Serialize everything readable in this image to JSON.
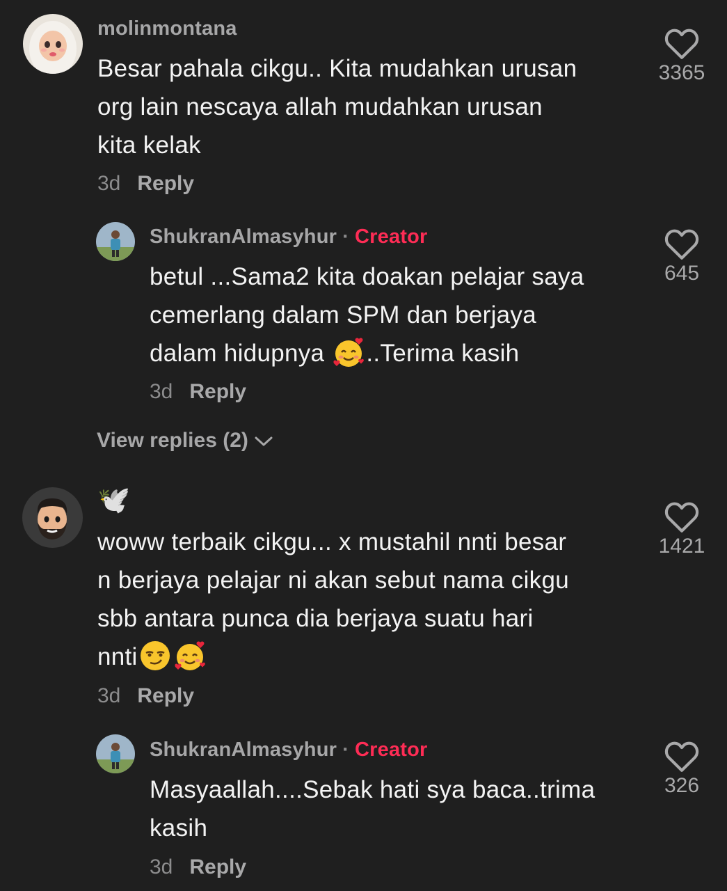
{
  "comments": [
    {
      "username": "molinmontana",
      "text": "Besar pahala cikgu.. Kita mudahkan urusan\norg lain nescaya allah mudahkan urusan\nkita kelak",
      "time": "3d",
      "reply_label": "Reply",
      "likes": "3365",
      "avatar_icon": "hijab-woman-avatar",
      "replies": [
        {
          "username": "ShukranAlmasyhur",
          "badge": "Creator",
          "separator": "·",
          "text_before_emoji": "betul ...Sama2 kita doakan pelajar saya\ncemerlang dalam SPM dan berjaya\ndalam hidupnya ",
          "emoji": "smiling-face-with-hearts",
          "text_after_emoji": "..Terima kasih",
          "time": "3d",
          "reply_label": "Reply",
          "likes": "645"
        }
      ],
      "view_replies": "View replies (2)"
    },
    {
      "username": "🕊️",
      "text_before_emoji": "woww terbaik cikgu... x mustahil nnti besar\nn berjaya pelajar ni akan sebut nama cikgu\nsbb antara punca dia berjaya suatu hari\nnnti",
      "emojis": [
        "smirking-face",
        "smiling-face-with-hearts"
      ],
      "time": "3d",
      "reply_label": "Reply",
      "likes": "1421",
      "avatar_icon": "bearded-man-avatar",
      "replies": [
        {
          "username": "ShukranAlmasyhur",
          "badge": "Creator",
          "separator": "·",
          "text": "Masyaallah....Sebak hati sya baca..trima\nkasih",
          "time": "3d",
          "reply_label": "Reply",
          "likes": "326"
        }
      ]
    }
  ],
  "colors": {
    "background": "#1f1f1f",
    "creator": "#fe2c55",
    "muted": "#a7a7a8",
    "text": "#f3f3f3"
  }
}
